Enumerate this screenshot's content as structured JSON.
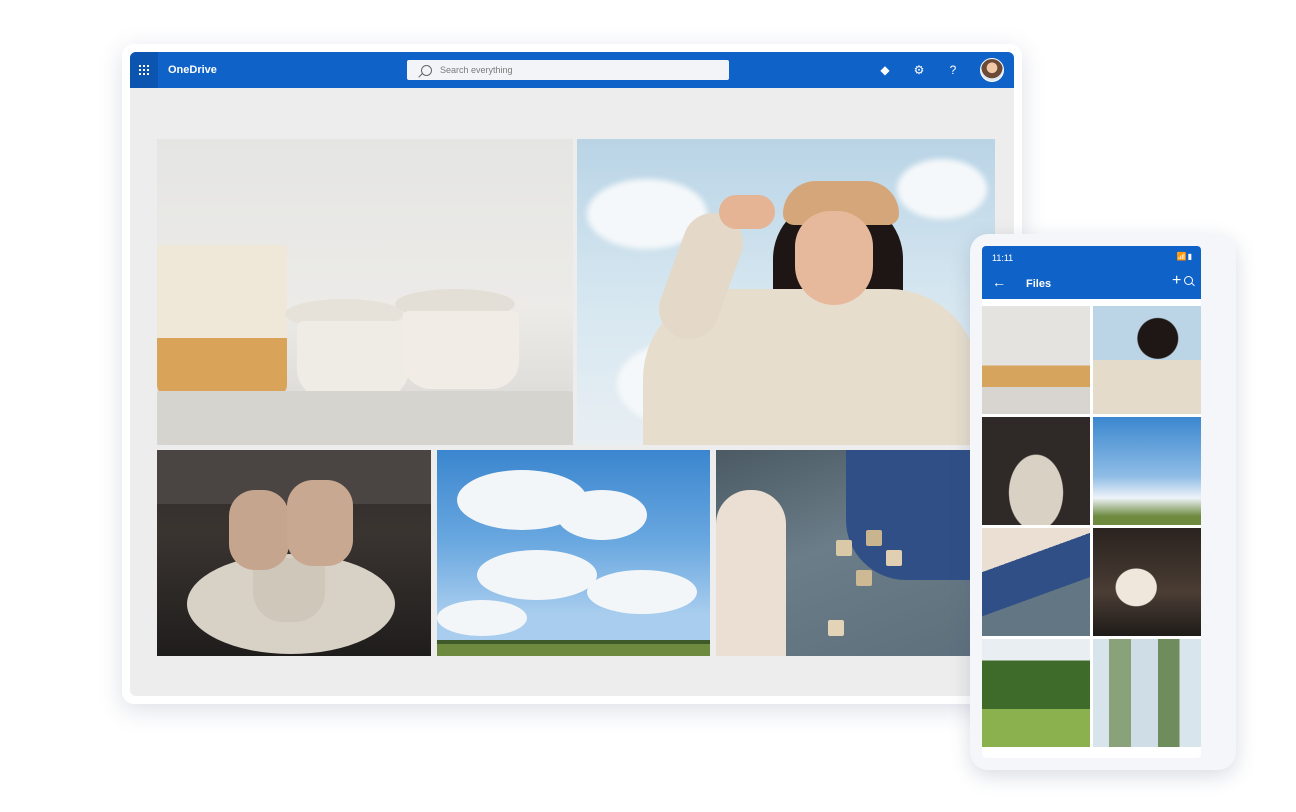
{
  "app": {
    "brand": "OneDrive",
    "search_placeholder": "Search everything",
    "top_icons": [
      {
        "name": "premium-diamond-icon",
        "glyph": "◆"
      },
      {
        "name": "settings-gear-icon",
        "glyph": "⚙"
      },
      {
        "name": "help-icon",
        "glyph": "?"
      }
    ],
    "accent": "#0f62c7"
  },
  "photos": [
    {
      "name": "photo-pottery-cups",
      "subject": "ceramic-cups"
    },
    {
      "name": "photo-woman-smiling",
      "subject": "portrait"
    },
    {
      "name": "photo-pottery-wheel",
      "subject": "pottery-wheel"
    },
    {
      "name": "photo-sky-clouds",
      "subject": "sky"
    },
    {
      "name": "photo-child-blocks",
      "subject": "toy-blocks"
    }
  ],
  "phone": {
    "status_time": "11:11",
    "status_icons": "📶▮",
    "title": "Files",
    "back_glyph": "←",
    "plus_glyph": "+"
  }
}
